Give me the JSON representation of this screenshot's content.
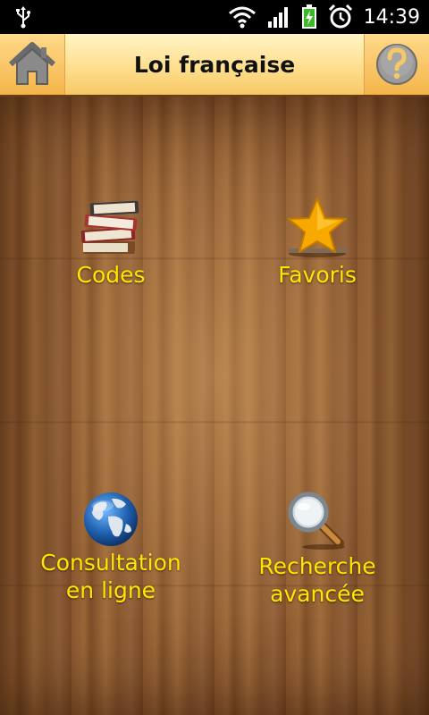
{
  "status_bar": {
    "time": "14:39",
    "icons": [
      "usb-icon",
      "wifi-icon",
      "signal-icon",
      "battery-charging-icon",
      "alarm-icon"
    ]
  },
  "header": {
    "title": "Loi française",
    "home_icon": "home-icon",
    "help_icon": "help-icon"
  },
  "menu": {
    "codes": {
      "label": "Codes",
      "icon": "books-icon"
    },
    "favoris": {
      "label": "Favoris",
      "icon": "star-icon"
    },
    "consultation": {
      "label": "Consultation\nen ligne",
      "icon": "globe-icon"
    },
    "recherche": {
      "label": "Recherche\navancée",
      "icon": "magnifier-icon"
    }
  },
  "colors": {
    "label_text": "#ffe600",
    "header_bg": "#ffdf8e",
    "wood": "#8b5a30"
  }
}
